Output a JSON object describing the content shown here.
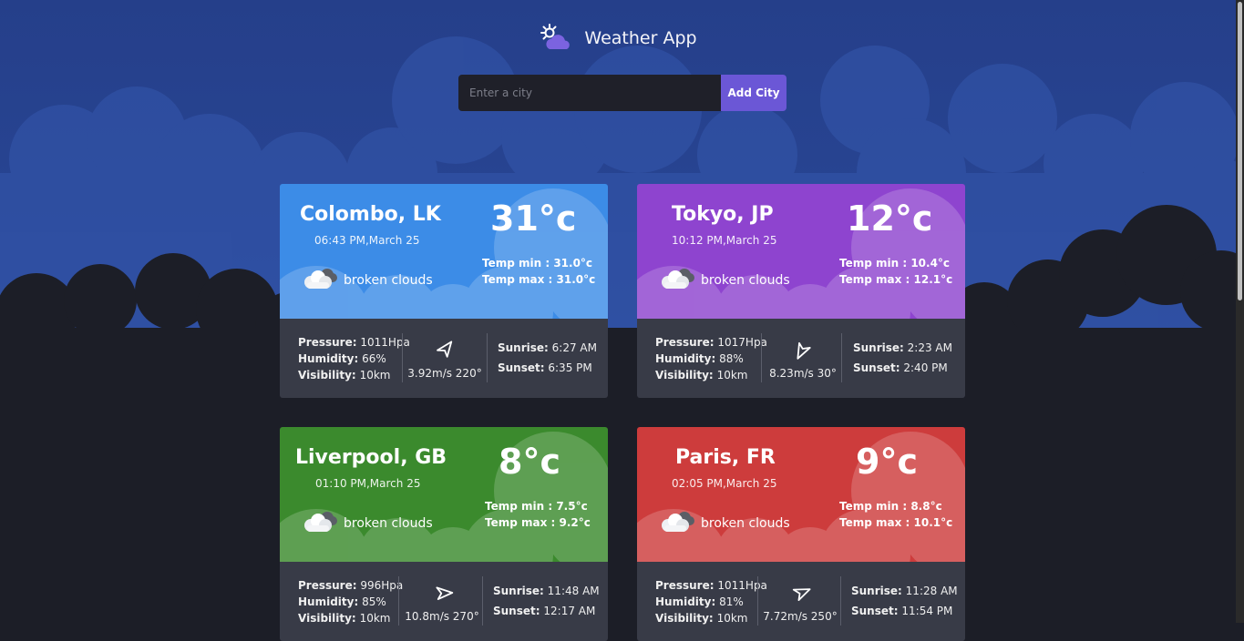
{
  "app": {
    "title": "Weather App",
    "icon": "sun-cloud-icon"
  },
  "search": {
    "placeholder": "Enter a city",
    "value": "",
    "button_label": "Add City"
  },
  "colors": {
    "background": "#2a4a9c",
    "accent": "#6b57d6",
    "cards": [
      "#3c8ce7",
      "#8e44cf",
      "#3b8a2d",
      "#cd3c3c"
    ],
    "card_bottom": "#383b47"
  },
  "labels": {
    "temp_min": "Temp min :",
    "temp_max": "Temp max :",
    "pressure": "Pressure:",
    "humidity": "Humidity:",
    "visibility": "Visibility:",
    "sunrise": "Sunrise:",
    "sunset": "Sunset:"
  },
  "cities": [
    {
      "name": "Colombo, LK",
      "time": "06:43 PM,March 25",
      "temp": "31°c",
      "condition": "broken clouds",
      "condition_icon": "broken-clouds-icon",
      "temp_min": "31.0°c",
      "temp_max": "31.0°c",
      "pressure": "1011Hpa",
      "humidity": "66%",
      "visibility": "10km",
      "wind": "3.92m/s 220°",
      "wind_deg": 220,
      "sunrise": "6:27 AM",
      "sunset": "6:35 PM"
    },
    {
      "name": "Tokyo, JP",
      "time": "10:12 PM,March 25",
      "temp": "12°c",
      "condition": "broken clouds",
      "condition_icon": "broken-clouds-icon",
      "temp_min": "10.4°c",
      "temp_max": "12.1°c",
      "pressure": "1017Hpa",
      "humidity": "88%",
      "visibility": "10km",
      "wind": "8.23m/s 30°",
      "wind_deg": 30,
      "sunrise": "2:23 AM",
      "sunset": "2:40 PM"
    },
    {
      "name": "Liverpool, GB",
      "time": "01:10 PM,March 25",
      "temp": "8°c",
      "condition": "broken clouds",
      "condition_icon": "broken-clouds-icon",
      "temp_min": "7.5°c",
      "temp_max": "9.2°c",
      "pressure": "996Hpa",
      "humidity": "85%",
      "visibility": "10km",
      "wind": "10.8m/s 270°",
      "wind_deg": 270,
      "sunrise": "11:48 AM",
      "sunset": "12:17 AM"
    },
    {
      "name": "Paris, FR",
      "time": "02:05 PM,March 25",
      "temp": "9°c",
      "condition": "broken clouds",
      "condition_icon": "broken-clouds-icon",
      "temp_min": "8.8°c",
      "temp_max": "10.1°c",
      "pressure": "1011Hpa",
      "humidity": "81%",
      "visibility": "10km",
      "wind": "7.72m/s 250°",
      "wind_deg": 250,
      "sunrise": "11:28 AM",
      "sunset": "11:54 PM"
    }
  ]
}
